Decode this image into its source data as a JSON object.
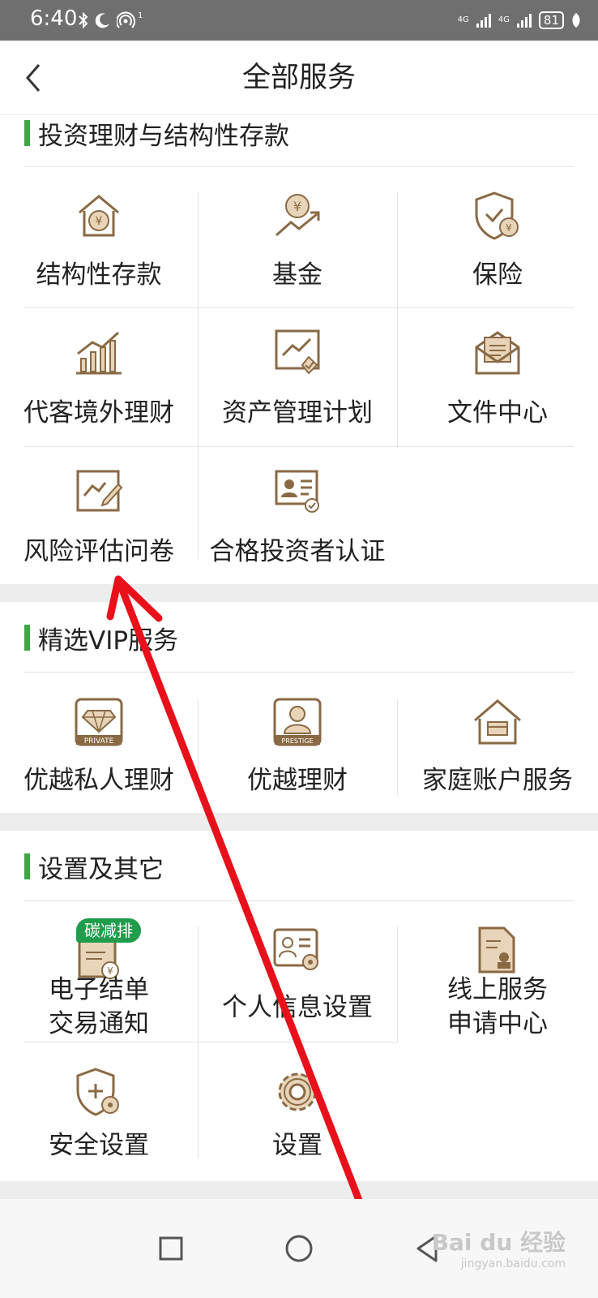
{
  "status": {
    "time": "6:40",
    "battery": "81",
    "net1": "4G",
    "net2": "4G",
    "wifi_sup": "1"
  },
  "header": {
    "title": "全部服务"
  },
  "sections": [
    {
      "title": "投资理财与结构性存款",
      "items": [
        {
          "label": "结构性存款",
          "icon": "house-yuan-icon"
        },
        {
          "label": "基金",
          "icon": "yuan-growth-icon"
        },
        {
          "label": "保险",
          "icon": "shield-yuan-icon"
        },
        {
          "label": "代客境外理财",
          "icon": "bar-chart-icon"
        },
        {
          "label": "资产管理计划",
          "icon": "chart-check-icon"
        },
        {
          "label": "文件中心",
          "icon": "envelope-document-icon"
        },
        {
          "label": "风险评估问卷",
          "icon": "chart-pencil-icon"
        },
        {
          "label": "合格投资者认证",
          "icon": "certificate-icon"
        }
      ]
    },
    {
      "title": "精选VIP服务",
      "items": [
        {
          "label": "优越私人理财",
          "icon": "private-diamond-icon",
          "icon_text": "PRIVATE"
        },
        {
          "label": "优越理财",
          "icon": "prestige-person-icon",
          "icon_text": "PRESTIGE"
        },
        {
          "label": "家庭账户服务",
          "icon": "house-card-icon"
        }
      ]
    },
    {
      "title": "设置及其它",
      "items": [
        {
          "label_line1": "电子结单",
          "label_line2": "交易通知",
          "icon": "statement-yuan-icon",
          "badge": "碳减排"
        },
        {
          "label": "个人信息设置",
          "icon": "id-card-gear-icon"
        },
        {
          "label_line1": "线上服务",
          "label_line2": "申请中心",
          "icon": "document-stamp-icon"
        },
        {
          "label": "安全设置",
          "icon": "shield-gear-icon"
        },
        {
          "label": "设置",
          "icon": "gear-icon"
        }
      ]
    }
  ],
  "nav": {
    "items": [
      "square-icon",
      "circle-icon",
      "triangle-back-icon"
    ]
  },
  "watermark": {
    "text": "Bai du 经验",
    "sub": "jingyan.baidu.com"
  },
  "colors": {
    "accent": "#3fa645",
    "icon_fill": "#e8d4b8",
    "icon_stroke": "#8a6a45",
    "arrow": "#e8101a"
  }
}
